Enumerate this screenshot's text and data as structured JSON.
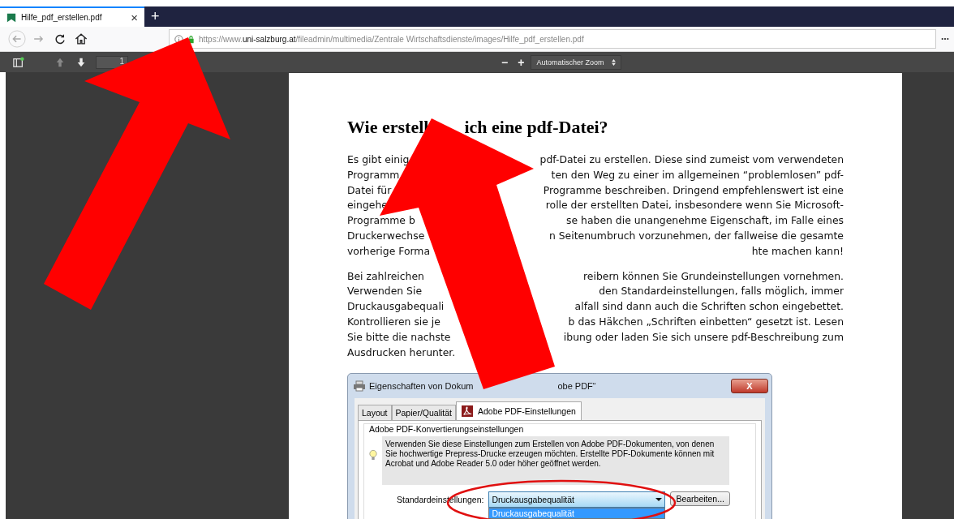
{
  "browser": {
    "tabs": [
      {
        "title": "Hilfe_pdf_erstellen.pdf",
        "selected": true,
        "close": "×"
      }
    ],
    "new_tab": "+",
    "url": "https://www.**uni-salzburg.at**/fileadmin/multimedia/Zentrale Wirtschaftsdienste/images/Hilfe_pdf_erstellen.pdf"
  },
  "pdf_toolbar": {
    "page_number": "1",
    "zoom_out": "−",
    "zoom_in": "+",
    "zoom_select": "Automatischer Zoom"
  },
  "document": {
    "title": [
      "Wie erstell",
      "ich eine pdf-Datei?"
    ],
    "paragraphs": [
      [
        [
          "Es gibt einig",
          "pdf-Datei zu erstellen. Diese sind zumeist vom verwendeten"
        ],
        [
          "Programm",
          "ten den Weg zu einer im allgemeinen “problemlosen” pdf-"
        ],
        [
          "Datei für",
          "Programme beschreiben. Dringend empfehlenswert ist eine"
        ],
        [
          "eingehe",
          "rolle der erstellten Datei, insbesondere wenn Sie Microsoft-"
        ],
        [
          "Programme b",
          "se haben die unangenehme Eigenschaft, im Falle eines"
        ],
        [
          "Druckerwechse",
          "n Seitenumbruch vorzunehmen, der fallweise die gesamte"
        ],
        [
          "vorherige Forma",
          "hte machen kann!"
        ]
      ],
      [
        [
          "Bei zahlreichen",
          "reibern können Sie Grundeinstellungen vornehmen."
        ],
        [
          "Verwenden Sie",
          "den Standardeinstellungen, falls möglich, immer"
        ],
        [
          "Druckausgabequali",
          "alfall sind dann auch die Schriften schon eingebettet."
        ],
        [
          "Kontrollieren sie je",
          "b das Häkchen „Schriften einbetten“ gesetzt ist. Lesen"
        ],
        [
          "Sie bitte die nachste",
          "ibung oder laden Sie sich unsere pdf-Beschreibung zum"
        ],
        [
          "Ausdrucken herunter."
        ]
      ]
    ]
  },
  "dialog": {
    "title": [
      "Eigenschaften von Dokum",
      "obe PDF“"
    ],
    "close": "X",
    "tabs": [
      {
        "label": "Layout",
        "selected": false,
        "kind": "text"
      },
      {
        "label": "Papier/Qualität",
        "selected": false,
        "kind": "text"
      },
      {
        "label": "Adobe PDF-Einstellungen",
        "selected": true,
        "kind": "pdf"
      }
    ],
    "group_label": "Adobe PDF-Konvertierungseinstellungen",
    "info": "Verwenden Sie diese Einstellungen zum Erstellen von Adobe PDF-Dokumenten, von denen Sie hochwertige Prepress-Drucke erzeugen möchten. Erstellte PDF-Dokumente können mit Acrobat und Adobe Reader 5.0 oder höher geöffnet werden.",
    "setting_label": "Standardeinstellungen:",
    "setting_value": "Druckausgabequalität",
    "edit_button": "Bearbeiten...",
    "dropdown_options": [
      {
        "label": "Druckausgabequalität",
        "selected": true
      }
    ]
  }
}
